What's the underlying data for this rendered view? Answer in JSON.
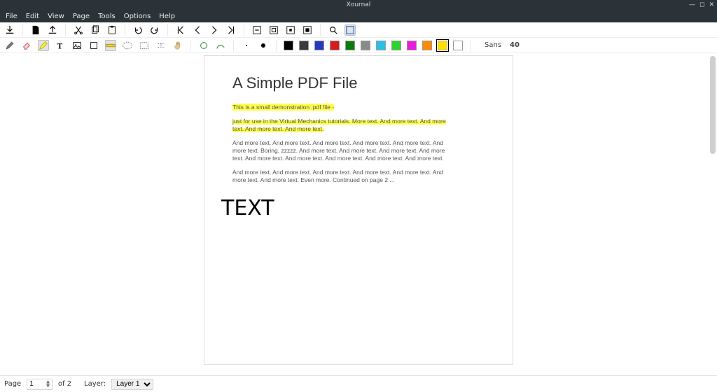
{
  "window": {
    "title": "Xournal"
  },
  "menu": {
    "file": "File",
    "edit": "Edit",
    "view": "View",
    "page": "Page",
    "tools": "Tools",
    "options": "Options",
    "help": "Help"
  },
  "toolbar1": {
    "save": "save",
    "newfile": "new",
    "open": "open",
    "cut": "cut",
    "copy": "copy",
    "paste": "paste",
    "undo": "undo",
    "redo": "redo",
    "first": "first-page",
    "prev": "prev-page",
    "next": "next-page",
    "last": "last-page",
    "zoomout": "zoom-out",
    "fitpage": "fit-page",
    "fitwidth": "fit-width",
    "zoomin": "zoom-in",
    "find": "find",
    "fullscreen": "fullscreen"
  },
  "toolbar2": {
    "pen": "pen",
    "eraser": "eraser",
    "highlighter": "highlighter",
    "text": "text",
    "image": "image",
    "shapes": "shapes",
    "ruler": "select-region",
    "selectrect": "select-rectangle",
    "vspace": "vertical-space",
    "hand": "hand",
    "default": "default",
    "fine": "fine",
    "medium": "medium",
    "thick": "thick"
  },
  "colors": {
    "list": [
      {
        "name": "black",
        "hex": "#000000"
      },
      {
        "name": "darkgray",
        "hex": "#3a3a3a"
      },
      {
        "name": "blue",
        "hex": "#2638c4"
      },
      {
        "name": "red",
        "hex": "#d81b1b"
      },
      {
        "name": "darkgreen",
        "hex": "#0b7a0b"
      },
      {
        "name": "gray",
        "hex": "#8a8a8a"
      },
      {
        "name": "lightblue",
        "hex": "#2bc0e6"
      },
      {
        "name": "green",
        "hex": "#2fd22f"
      },
      {
        "name": "magenta",
        "hex": "#e51fdc"
      },
      {
        "name": "orange",
        "hex": "#ff8a00"
      },
      {
        "name": "yellow",
        "hex": "#ffe000",
        "selected": true
      },
      {
        "name": "white",
        "hex": "#ffffff"
      }
    ]
  },
  "font": {
    "label": "Sans",
    "size": "40"
  },
  "document": {
    "title": "A Simple PDF File",
    "p1": "This is a small demonstration .pdf file -",
    "p2": "just for use in the Virtual Mechanics tutorials. More text. And more text. And more text. And more text. And more text.",
    "p3": "And more text. And more text. And more text. And more text. And more text. And more text. Boring, zzzzz. And more text. And more text. And more text. And more text. And more text. And more text. And more text. And more text. And more text.",
    "p4": "And more text. And more text. And more text. And more text. And more text. And more text. And more text. Even more. Continued on page 2 ...",
    "annotation": "TEXT"
  },
  "status": {
    "page_label": "Page",
    "page_current": "1",
    "of_label": "of 2",
    "layer_label": "Layer:",
    "layer_value": "Layer 1"
  }
}
